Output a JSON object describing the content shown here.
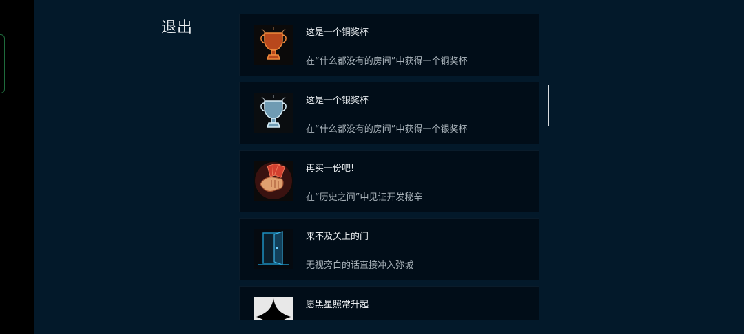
{
  "header": {
    "exit_label": "退出"
  },
  "achievements": [
    {
      "title": "这是一个铜奖杯",
      "description": "在“什么都没有的房间”中获得一个铜奖杯",
      "icon": "bronze-trophy-icon"
    },
    {
      "title": "这是一个银奖杯",
      "description": "在“什么都没有的房间”中获得一个银奖杯",
      "icon": "silver-trophy-icon"
    },
    {
      "title": "再买一份吧!",
      "description": "在“历史之间”中见证开发秘辛",
      "icon": "fist-with-cards-icon"
    },
    {
      "title": "来不及关上的门",
      "description": "无视旁白的话直接冲入弥城",
      "icon": "open-door-icon"
    },
    {
      "title": "愿黑星照常升起",
      "description": "",
      "icon": "black-star-icon"
    }
  ],
  "colors": {
    "background": "#03192a",
    "card": "#010d18",
    "bronze": "#e0662b",
    "silver": "#a9d4ea",
    "red": "#c73a2d",
    "door_blue": "#1c8fbf"
  }
}
